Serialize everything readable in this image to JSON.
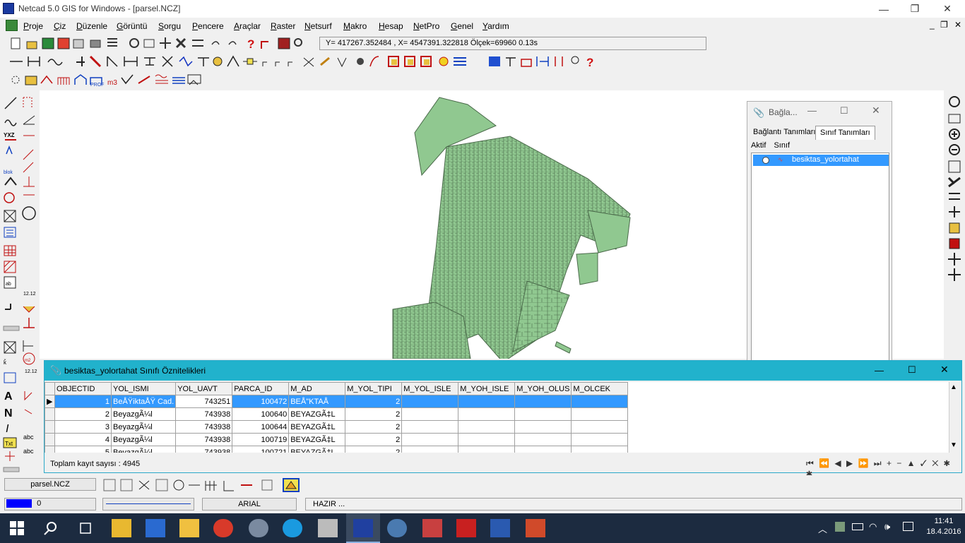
{
  "window": {
    "title": "Netcad 5.0 GIS for Windows - [parsel.NCZ]",
    "minimize": "—",
    "restore": "❐",
    "close": "✕"
  },
  "menu": {
    "items": [
      "Proje",
      "Çiz",
      "Düzenle",
      "Görüntü",
      "Sorgu",
      "Pencere",
      "Araçlar",
      "Raster",
      "Netsurf",
      "Makro",
      "Hesap",
      "NetPro",
      "Genel",
      "Yardım"
    ],
    "mdi_minimize": "_",
    "mdi_restore": "❐",
    "mdi_close": "✕"
  },
  "coordinate_readout": "Y= 417267.352484 , X= 4547391.322818 Ölçek=69960   0.13s",
  "colors": {
    "map_fill": "#90c890",
    "map_stroke": "#4a6a4a",
    "panel_header": "#21b2cc",
    "selection": "#3399ff",
    "taskbar": "#1c2b40"
  },
  "layer_panel": {
    "title": "Bağla...",
    "tabs": [
      "Bağlantı Tanımları",
      "Sınıf Tanımları"
    ],
    "columns": [
      "Aktif",
      "Sınıf"
    ],
    "items": [
      "besiktas_yolortahat"
    ]
  },
  "attribute_window": {
    "title": "besiktas_yolortahat Sınıfı Öznitelikleri",
    "columns": [
      "OBJECTID",
      "YOL_ISMI",
      "YOL_UAVT",
      "PARCA_ID",
      "M_AD",
      "M_YOL_TIPI",
      "M_YOL_ISLE",
      "M_YOH_ISLE",
      "M_YOH_OLUS",
      "M_OLCEK"
    ],
    "rows": [
      [
        "1",
        "BeÅŸiktaÅŸ Cad.",
        "743251",
        "100472",
        "BEÅ\"KTAÅ",
        "2",
        "",
        "",
        "",
        ""
      ],
      [
        "2",
        "BeyazgÃ¼l",
        "743938",
        "100640",
        "BEYAZGÃ‡L",
        "2",
        "",
        "",
        "",
        ""
      ],
      [
        "3",
        "BeyazgÃ¼l",
        "743938",
        "100644",
        "BEYAZGÃ‡L",
        "2",
        "",
        "",
        "",
        ""
      ],
      [
        "4",
        "BeyazgÃ¼l",
        "743938",
        "100719",
        "BEYAZGÃ‡L",
        "2",
        "",
        "",
        "",
        ""
      ],
      [
        "5",
        "BeyazgÃ¼l",
        "743938",
        "100721",
        "BEYAZGÃ‡L",
        "2",
        "",
        "",
        "",
        ""
      ]
    ],
    "record_count": "Toplam kayıt sayısı : 4945",
    "nav_buttons": "⏮ ⏪ ◀ ▶ ⏩ ⏭ + − ▲ ✓ ✕ ✱ ✱"
  },
  "status": {
    "file_tab": "parsel.NCZ",
    "layer_value": "0",
    "font_name": "ARIAL",
    "state": "HAZIR ..."
  },
  "taskbar": {
    "time": "11:41",
    "date": "18.4.2016"
  }
}
